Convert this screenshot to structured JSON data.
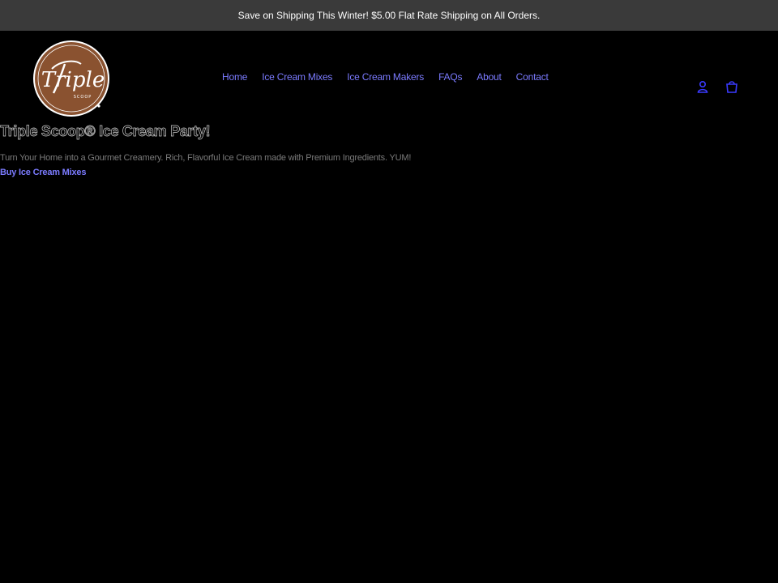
{
  "announcement": {
    "text": "Save on Shipping This Winter! $5.00 Flat Rate Shipping on All Orders."
  },
  "brand": {
    "logo_word": "Triple",
    "logo_subword": "SCOOP",
    "logo_color": "#8a5230"
  },
  "nav": {
    "items": [
      {
        "label": "Home"
      },
      {
        "label": "Ice Cream Mixes"
      },
      {
        "label": "Ice Cream Makers"
      },
      {
        "label": "FAQs"
      },
      {
        "label": "About"
      },
      {
        "label": "Contact"
      }
    ],
    "link_color": "#7b7bff"
  },
  "header_icons": [
    "account-icon",
    "cart-icon"
  ],
  "hero": {
    "title": "Triple Scoop® Ice Cream Party!",
    "subtitle": "Turn Your Home into a Gourmet Creamery. Rich, Flavorful Ice Cream made with Premium Ingredients. YUM!",
    "cta": "Buy Ice Cream Mixes"
  }
}
